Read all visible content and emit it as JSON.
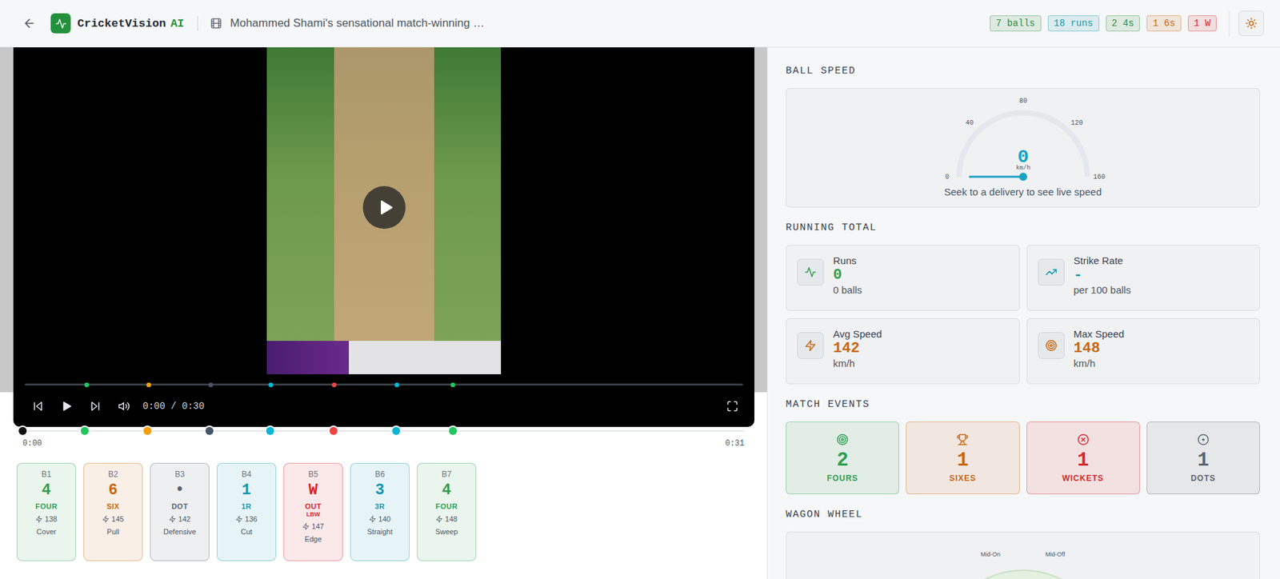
{
  "header": {
    "brand": {
      "name": "CricketVision",
      "suffix": "AI"
    },
    "title": "Mohammed Shami's sensational match-winning …",
    "stats": [
      {
        "text": "7 balls",
        "color": "#2e8b3e"
      },
      {
        "text": "18 runs",
        "color": "#1596b0"
      },
      {
        "text": "2 4s",
        "color": "#2e8b3e"
      },
      {
        "text": "1 6s",
        "color": "#c8660f"
      },
      {
        "text": "1 W",
        "color": "#d7262c"
      }
    ]
  },
  "player": {
    "time": "0:00 / 0:30",
    "playing": false
  },
  "timeline": {
    "start": "0:00",
    "end": "0:31",
    "playhead": 0,
    "markers": [
      {
        "level": 0.086,
        "color": "#22c55e"
      },
      {
        "level": 0.173,
        "color": "#f59e0b"
      },
      {
        "level": 0.259,
        "color": "#475569"
      },
      {
        "level": 0.343,
        "color": "#06b6d4"
      },
      {
        "level": 0.431,
        "color": "#ef4444"
      },
      {
        "level": 0.518,
        "color": "#06b6d4"
      },
      {
        "level": 0.596,
        "color": "#22c55e"
      }
    ]
  },
  "balls": [
    {
      "label": "B1",
      "value": "4",
      "outcome": "FOUR",
      "speed": "138",
      "shot": "Cover",
      "color": "#2e9e4f"
    },
    {
      "label": "B2",
      "value": "6",
      "outcome": "SIX",
      "speed": "145",
      "shot": "Pull",
      "color": "#c8660f"
    },
    {
      "label": "B3",
      "value": "•",
      "outcome": "DOT",
      "speed": "142",
      "shot": "Defensive",
      "color": "#5b6470"
    },
    {
      "label": "B4",
      "value": "1",
      "outcome": "1R",
      "speed": "136",
      "shot": "Cut",
      "color": "#1596b0"
    },
    {
      "label": "B5",
      "value": "W",
      "outcome": "OUT",
      "detail": "LBW",
      "speed": "147",
      "shot": "Edge",
      "color": "#d7262c"
    },
    {
      "label": "B6",
      "value": "3",
      "outcome": "3R",
      "speed": "140",
      "shot": "Straight",
      "color": "#1596b0"
    },
    {
      "label": "B7",
      "value": "4",
      "outcome": "FOUR",
      "speed": "148",
      "shot": "Sweep",
      "color": "#2e9e4f"
    }
  ],
  "speed_panel": {
    "title": "BALL SPEED",
    "ticks": [
      "0",
      "40",
      "80",
      "120",
      "160"
    ],
    "value": "0",
    "unit": "km/h",
    "level": 0,
    "hint": "Seek to a delivery to see live speed"
  },
  "running_total": {
    "title": "RUNNING TOTAL",
    "cards": [
      {
        "label": "Runs",
        "value": "0",
        "sub": "0 balls",
        "color": "#2e9e4f"
      },
      {
        "label": "Strike Rate",
        "value": "-",
        "sub": "per 100 balls",
        "color": "#1596b0"
      },
      {
        "label": "Avg Speed",
        "value": "142",
        "sub": "km/h",
        "color": "#c8660f"
      },
      {
        "label": "Max Speed",
        "value": "148",
        "sub": "km/h",
        "color": "#c8660f"
      }
    ]
  },
  "match_events": {
    "title": "MATCH EVENTS",
    "cards": [
      {
        "value": "2",
        "label": "FOURS",
        "color": "#2e9e4f"
      },
      {
        "value": "1",
        "label": "SIXES",
        "color": "#c8660f"
      },
      {
        "value": "1",
        "label": "WICKETS",
        "color": "#d7262c"
      },
      {
        "value": "1",
        "label": "DOTS",
        "color": "#5b6470"
      }
    ]
  },
  "wagon_wheel": {
    "title": "WAGON WHEEL",
    "labels": [
      "Mid-On",
      "Mid-Off"
    ]
  }
}
